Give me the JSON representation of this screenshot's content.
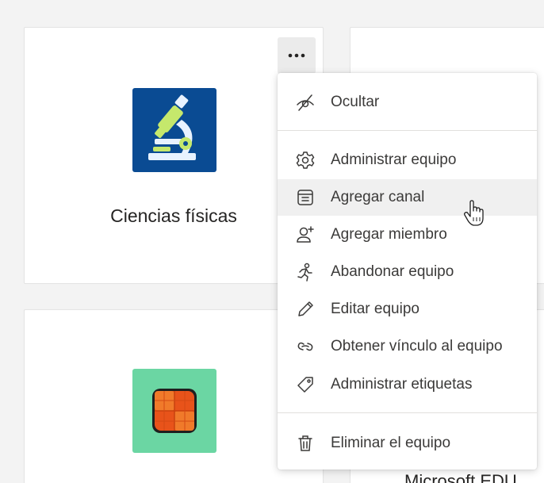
{
  "teams": [
    {
      "name": "Ciencias físicas",
      "icon": "microscope-icon",
      "avatar_color": "#0a4b93"
    },
    {
      "name": "",
      "icon": "orange-grid-icon",
      "avatar_color": "#6bd6a3"
    }
  ],
  "partial_team_name": "Microsoft EDU",
  "more_options_label": "···",
  "context_menu": {
    "items": [
      {
        "label": "Ocultar",
        "icon": "hide-icon"
      },
      {
        "label": "Administrar equipo",
        "icon": "gear-icon"
      },
      {
        "label": "Agregar canal",
        "icon": "channel-list-icon"
      },
      {
        "label": "Agregar miembro",
        "icon": "add-person-icon"
      },
      {
        "label": "Abandonar equipo",
        "icon": "leave-running-icon"
      },
      {
        "label": "Editar equipo",
        "icon": "pencil-icon"
      },
      {
        "label": "Obtener vínculo al equipo",
        "icon": "link-icon"
      },
      {
        "label": "Administrar etiquetas",
        "icon": "tag-icon"
      },
      {
        "label": "Eliminar el equipo",
        "icon": "trash-icon"
      }
    ],
    "hovered_item": "Agregar canal"
  },
  "colors": {
    "background": "#f3f3f3",
    "card": "#ffffff",
    "menu_hover": "#f0f0f0",
    "text": "#3b3a39"
  }
}
